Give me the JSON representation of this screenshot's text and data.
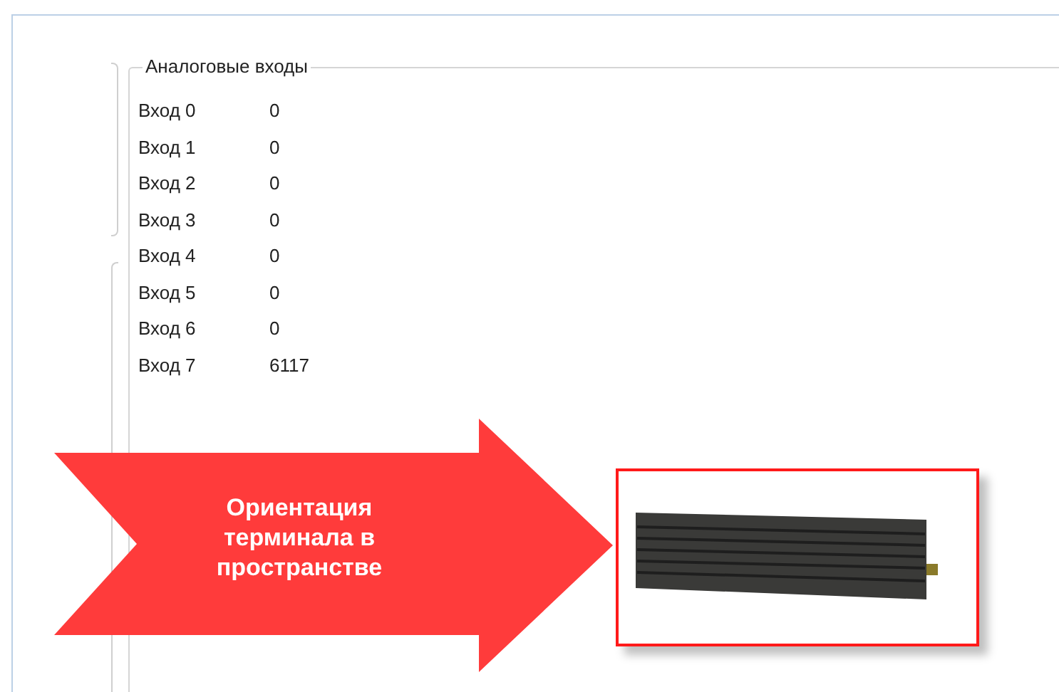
{
  "group": {
    "title": "Аналоговые входы"
  },
  "inputs": [
    {
      "label": "Вход 0",
      "value": "0"
    },
    {
      "label": "Вход 1",
      "value": "0"
    },
    {
      "label": "Вход 2",
      "value": "0"
    },
    {
      "label": "Вход 3",
      "value": "0"
    },
    {
      "label": "Вход 4",
      "value": "0"
    },
    {
      "label": "Вход 5",
      "value": "0"
    },
    {
      "label": "Вход 6",
      "value": "0"
    },
    {
      "label": "Вход 7",
      "value": "6117"
    }
  ],
  "callout": {
    "text": "Ориентация терминала в пространстве"
  }
}
